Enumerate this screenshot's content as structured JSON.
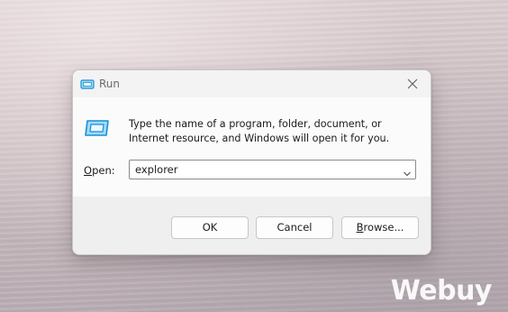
{
  "dialog": {
    "title": "Run",
    "description": "Type the name of a program, folder, document, or Internet resource, and Windows will open it for you.",
    "open_label_accel": "O",
    "open_label_rest": "pen:",
    "open_value": "explorer",
    "buttons": {
      "ok": "OK",
      "cancel": "Cancel",
      "browse_accel": "B",
      "browse_rest": "rowse..."
    }
  },
  "watermark": "Webuy",
  "icons": {
    "title": "run-app-icon",
    "main": "run-app-icon",
    "close": "close-icon",
    "dropdown": "chevron-down-icon"
  },
  "colors": {
    "accent": "#1a8fd6",
    "icon_fill": "#9fdcf6"
  }
}
